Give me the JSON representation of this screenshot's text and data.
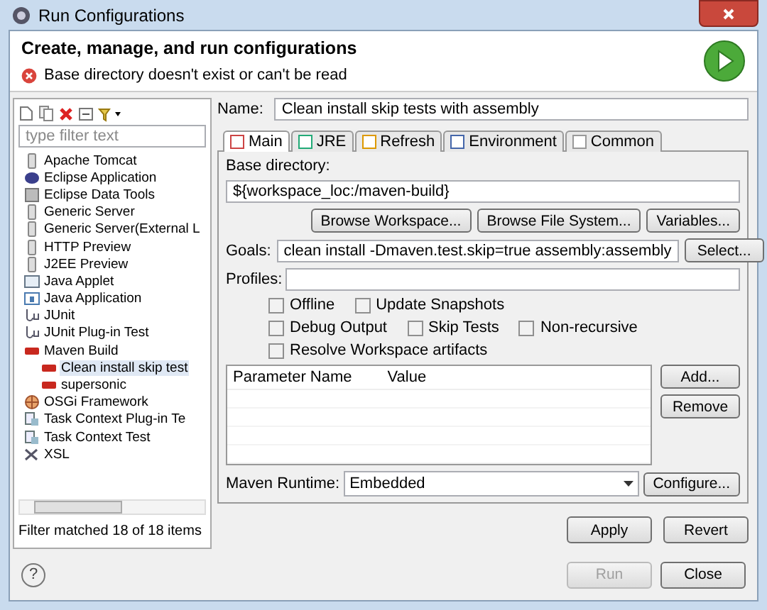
{
  "window": {
    "title": "Run Configurations"
  },
  "header": {
    "title": "Create, manage, and run configurations",
    "message": "Base directory doesn't exist or can't be read"
  },
  "sidebar": {
    "filter": {
      "placeholder": "type filter text"
    },
    "items": [
      {
        "label": "Apache Tomcat",
        "kind": "server",
        "selected": false
      },
      {
        "label": "Eclipse Application",
        "kind": "eclipse",
        "selected": false
      },
      {
        "label": "Eclipse Data Tools",
        "kind": "database",
        "selected": false
      },
      {
        "label": "Generic Server",
        "kind": "server",
        "selected": false
      },
      {
        "label": "Generic Server(External L",
        "kind": "server",
        "selected": false
      },
      {
        "label": "HTTP Preview",
        "kind": "server",
        "selected": false
      },
      {
        "label": "J2EE Preview",
        "kind": "server",
        "selected": false
      },
      {
        "label": "Java Applet",
        "kind": "applet",
        "selected": false
      },
      {
        "label": "Java Application",
        "kind": "application",
        "selected": false
      },
      {
        "label": "JUnit",
        "kind": "junit",
        "selected": false
      },
      {
        "label": "JUnit Plug-in Test",
        "kind": "junit",
        "selected": false
      },
      {
        "label": "Maven Build",
        "kind": "maven",
        "selected": false,
        "children": [
          {
            "label": "Clean install skip test",
            "kind": "maven",
            "selected": true
          },
          {
            "label": "supersonic",
            "kind": "maven",
            "selected": false
          }
        ]
      },
      {
        "label": "OSGi Framework",
        "kind": "osgi",
        "selected": false
      },
      {
        "label": "Task Context Plug-in Te",
        "kind": "task",
        "selected": false
      },
      {
        "label": "Task Context Test",
        "kind": "task",
        "selected": false
      },
      {
        "label": "XSL",
        "kind": "xsl",
        "selected": false
      }
    ],
    "status": "Filter matched 18 of 18 items"
  },
  "name": {
    "label": "Name:",
    "value": "Clean install skip tests with assembly"
  },
  "tabs": [
    {
      "label": "Main",
      "selected": true
    },
    {
      "label": "JRE",
      "selected": false
    },
    {
      "label": "Refresh",
      "selected": false
    },
    {
      "label": "Environment",
      "selected": false
    },
    {
      "label": "Common",
      "selected": false
    }
  ],
  "main": {
    "base_directory": {
      "label": "Base directory:",
      "value": "${workspace_loc:/maven-build}"
    },
    "browse_buttons": [
      "Browse Workspace...",
      "Browse File System...",
      "Variables..."
    ],
    "goals": {
      "label": "Goals:",
      "value": "clean install -Dmaven.test.skip=true assembly:assembly",
      "button": "Select..."
    },
    "profiles": {
      "label": "Profiles:"
    },
    "options": [
      [
        {
          "label": "Offline",
          "checked": false
        },
        {
          "label": "Update Snapshots",
          "checked": false
        }
      ],
      [
        {
          "label": "Debug Output",
          "checked": false
        },
        {
          "label": "Skip Tests",
          "checked": false
        },
        {
          "label": "Non-recursive",
          "checked": false
        }
      ],
      [
        {
          "label": "Resolve Workspace artifacts",
          "checked": false
        }
      ]
    ],
    "parameters": {
      "columns": [
        "Parameter Name",
        "Value"
      ],
      "buttons": [
        "Add...",
        "Remove"
      ]
    },
    "runtime": {
      "label": "Maven Runtime:",
      "value": "Embedded",
      "button": "Configure..."
    }
  },
  "actions": [
    {
      "label": "Apply",
      "disabled": false
    },
    {
      "label": "Revert",
      "disabled": false
    }
  ],
  "footer": {
    "help": "?",
    "buttons": [
      {
        "label": "Run",
        "disabled": true
      },
      {
        "label": "Close",
        "disabled": false
      }
    ]
  }
}
